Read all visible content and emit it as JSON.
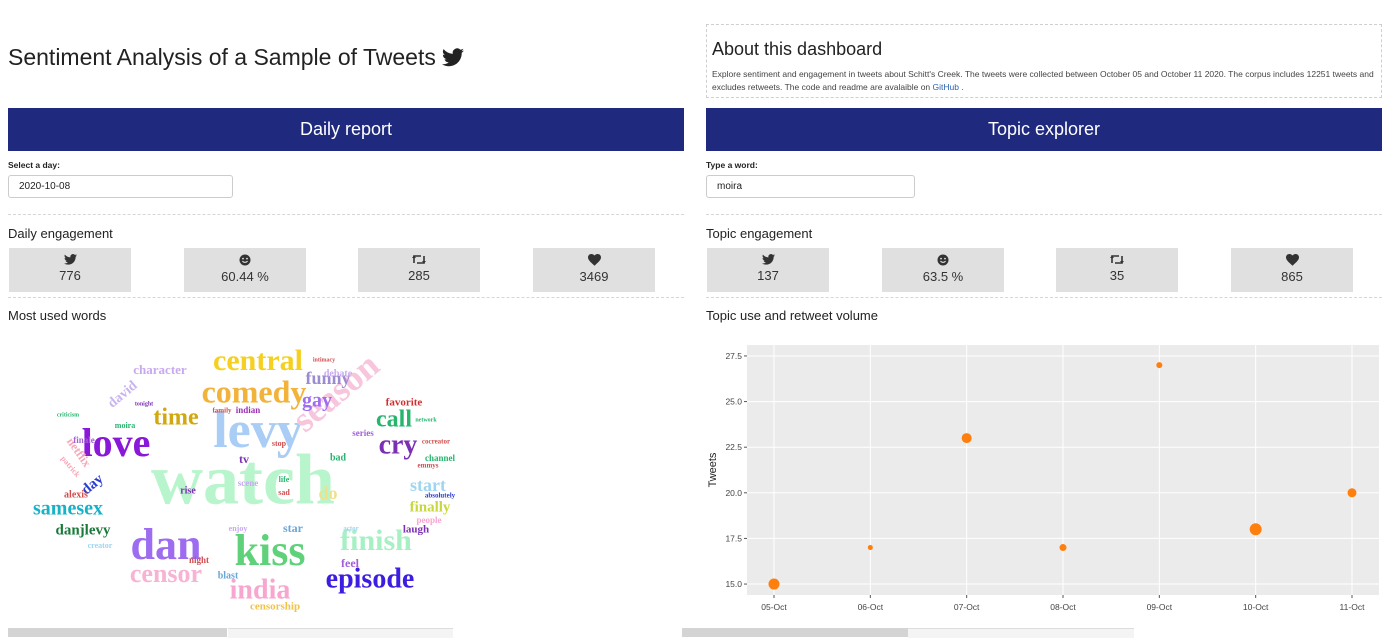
{
  "header": {
    "title": "Sentiment Analysis of a Sample of Tweets",
    "icon": "twitter-bird-icon"
  },
  "about": {
    "heading": "About this dashboard",
    "text": "Explore sentiment and engagement in tweets about Schitt's Creek. The tweets were collected between October 05 and October 11 2020. The corpus includes 12251 tweets and excludes retweets. The code and readme are avalaible on",
    "link": "GitHub",
    "tail": " ."
  },
  "daily": {
    "banner": "Daily report",
    "input_label": "Select a day:",
    "input_value": "2020-10-08",
    "engagement_title": "Daily engagement",
    "stats": [
      {
        "icon": "twitter-icon",
        "value": "776"
      },
      {
        "icon": "smiley-icon",
        "value": "60.44 %"
      },
      {
        "icon": "retweet-icon",
        "value": "285"
      },
      {
        "icon": "heart-icon",
        "value": "3469"
      }
    ],
    "words_title": "Most used words"
  },
  "topic": {
    "banner": "Topic explorer",
    "input_label": "Type a word:",
    "input_value": "moira",
    "engagement_title": "Topic engagement",
    "stats": [
      {
        "icon": "twitter-icon",
        "value": "137"
      },
      {
        "icon": "smiley-icon",
        "value": "63.5 %"
      },
      {
        "icon": "retweet-icon",
        "value": "35"
      },
      {
        "icon": "heart-icon",
        "value": "865"
      }
    ],
    "chart_title": "Topic use and retweet volume"
  },
  "wordcloud": [
    {
      "word": "watch",
      "size": 72,
      "color": "#b8f5cc",
      "weight": 1.0
    },
    {
      "word": "levy",
      "size": 52,
      "color": "#a9cdf5",
      "weight": 0.8
    },
    {
      "word": "kiss",
      "size": 44,
      "color": "#5fd17a",
      "weight": 0.7
    },
    {
      "word": "dan",
      "size": 44,
      "color": "#9d6cf0",
      "weight": 0.7
    },
    {
      "word": "love",
      "size": 40,
      "color": "#8a18d8",
      "weight": 0.6
    },
    {
      "word": "season",
      "size": 36,
      "color": "#f7c6dc",
      "weight": 0.6
    },
    {
      "word": "comedy",
      "size": 32,
      "color": "#f2b33a",
      "weight": 0.5
    },
    {
      "word": "central",
      "size": 30,
      "color": "#f5d020",
      "weight": 0.5
    },
    {
      "word": "finish",
      "size": 30,
      "color": "#a6f0c4",
      "weight": 0.5
    },
    {
      "word": "episode",
      "size": 28,
      "color": "#3d1de0",
      "weight": 0.45
    },
    {
      "word": "india",
      "size": 28,
      "color": "#f7a6d0",
      "weight": 0.45
    },
    {
      "word": "censor",
      "size": 26,
      "color": "#f7b2d4",
      "weight": 0.4
    },
    {
      "word": "cry",
      "size": 28,
      "color": "#7b2fb5",
      "weight": 0.4
    },
    {
      "word": "call",
      "size": 24,
      "color": "#27b56e",
      "weight": 0.35
    },
    {
      "word": "time",
      "size": 24,
      "color": "#d1a80e",
      "weight": 0.35
    },
    {
      "word": "samesex",
      "size": 20,
      "color": "#16b2c7",
      "weight": 0.3
    },
    {
      "word": "gay",
      "size": 20,
      "color": "#9d6cf0",
      "weight": 0.3
    },
    {
      "word": "funny",
      "size": 18,
      "color": "#9b8bd1",
      "weight": 0.28
    },
    {
      "word": "start",
      "size": 18,
      "color": "#9ed5f0",
      "weight": 0.28
    },
    {
      "word": "finally",
      "size": 15,
      "color": "#c8d83c",
      "weight": 0.22
    },
    {
      "word": "danjlevy",
      "size": 15,
      "color": "#1a7a3a",
      "weight": 0.22
    },
    {
      "word": "do",
      "size": 18,
      "color": "#f0e08a",
      "weight": 0.25
    },
    {
      "word": "character",
      "size": 13,
      "color": "#c8a9f0",
      "weight": 0.2
    },
    {
      "word": "david",
      "size": 14,
      "color": "#c8b4f0",
      "weight": 0.2
    },
    {
      "word": "day",
      "size": 15,
      "color": "#2a3fd0",
      "weight": 0.22
    },
    {
      "word": "favorite",
      "size": 11,
      "color": "#d12d2d",
      "weight": 0.18
    },
    {
      "word": "netflix",
      "size": 12,
      "color": "#f7a6b8",
      "weight": 0.18
    },
    {
      "word": "star",
      "size": 12,
      "color": "#6aa6d8",
      "weight": 0.18
    },
    {
      "word": "tv",
      "size": 12,
      "color": "#7b2fb5",
      "weight": 0.18
    },
    {
      "word": "feel",
      "size": 12,
      "color": "#a35fd8",
      "weight": 0.18
    },
    {
      "word": "laugh",
      "size": 11,
      "color": "#7b2fb5",
      "weight": 0.15
    },
    {
      "word": "censorship",
      "size": 11,
      "color": "#f0c24a",
      "weight": 0.15
    },
    {
      "word": "blast",
      "size": 10,
      "color": "#6aa6d8",
      "weight": 0.12
    },
    {
      "word": "alexis",
      "size": 10,
      "color": "#d14d4d",
      "weight": 0.12
    },
    {
      "word": "bad",
      "size": 10,
      "color": "#27b56e",
      "weight": 0.12
    },
    {
      "word": "debate",
      "size": 10,
      "color": "#c8a9f0",
      "weight": 0.12
    },
    {
      "word": "rise",
      "size": 10,
      "color": "#7b2fb5",
      "weight": 0.12
    },
    {
      "word": "finale",
      "size": 9,
      "color": "#a35fd8",
      "weight": 0.1
    },
    {
      "word": "series",
      "size": 9,
      "color": "#a35fd8",
      "weight": 0.1
    },
    {
      "word": "channel",
      "size": 9,
      "color": "#27b56e",
      "weight": 0.1
    },
    {
      "word": "night",
      "size": 9,
      "color": "#d14d4d",
      "weight": 0.1
    },
    {
      "word": "scene",
      "size": 9,
      "color": "#c8a9f0",
      "weight": 0.1
    },
    {
      "word": "indian",
      "size": 9,
      "color": "#9b2fb5",
      "weight": 0.1
    },
    {
      "word": "people",
      "size": 9,
      "color": "#f7a6d0",
      "weight": 0.1
    },
    {
      "word": "moira",
      "size": 8,
      "color": "#27b56e",
      "weight": 0.08
    },
    {
      "word": "stop",
      "size": 8,
      "color": "#d14d4d",
      "weight": 0.08
    },
    {
      "word": "life",
      "size": 8,
      "color": "#27b56e",
      "weight": 0.08
    },
    {
      "word": "sad",
      "size": 8,
      "color": "#d14d4d",
      "weight": 0.08
    },
    {
      "word": "patrick",
      "size": 8,
      "color": "#f7a6b8",
      "weight": 0.08
    },
    {
      "word": "creator",
      "size": 8,
      "color": "#9ed5f0",
      "weight": 0.08
    },
    {
      "word": "enjoy",
      "size": 8,
      "color": "#c8a9f0",
      "weight": 0.08
    },
    {
      "word": "actor",
      "size": 7,
      "color": "#9ed5f0",
      "weight": 0.06
    },
    {
      "word": "emmys",
      "size": 7,
      "color": "#d14d4d",
      "weight": 0.06
    },
    {
      "word": "family",
      "size": 7,
      "color": "#d14d4d",
      "weight": 0.06
    },
    {
      "word": "absolutely",
      "size": 7,
      "color": "#2a3fd0",
      "weight": 0.06
    },
    {
      "word": "cocreator",
      "size": 7,
      "color": "#d14d4d",
      "weight": 0.06
    },
    {
      "word": "network",
      "size": 6,
      "color": "#27b56e",
      "weight": 0.05
    },
    {
      "word": "intimacy",
      "size": 6,
      "color": "#d14d4d",
      "weight": 0.05
    },
    {
      "word": "criticism",
      "size": 6,
      "color": "#27b56e",
      "weight": 0.05
    },
    {
      "word": "tonight",
      "size": 6,
      "color": "#7b2fb5",
      "weight": 0.05
    }
  ],
  "chart_data": {
    "type": "scatter",
    "title": "",
    "xlabel": "",
    "ylabel": "Tweets",
    "x": [
      "05-Oct",
      "06-Oct",
      "07-Oct",
      "08-Oct",
      "09-Oct",
      "10-Oct",
      "11-Oct"
    ],
    "y": [
      15,
      17,
      23,
      17,
      27,
      18,
      20
    ],
    "size": [
      10,
      4,
      9,
      6,
      5,
      11,
      8
    ],
    "y_ticks": [
      "15.0",
      "17.5",
      "20.0",
      "22.5",
      "25.0",
      "27.5"
    ],
    "ylim": [
      14.4,
      28.1
    ],
    "point_color": "#ff7f0e",
    "grid": true,
    "background": "#ebebeb"
  }
}
